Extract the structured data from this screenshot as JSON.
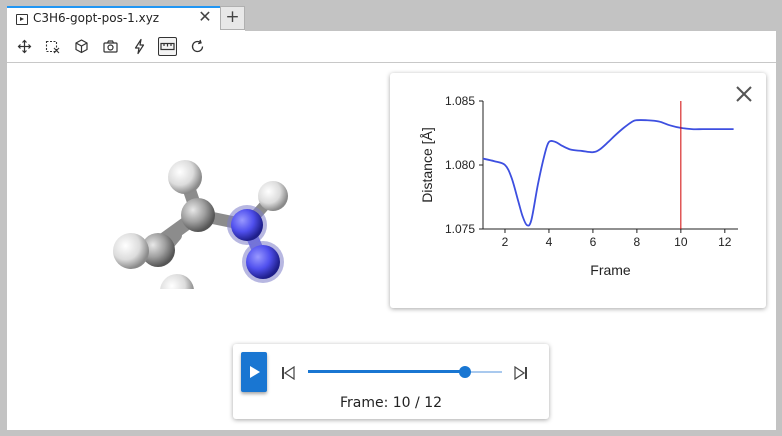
{
  "tab": {
    "title": "C3H6-gopt-pos-1.xyz",
    "close_symbol": "✕",
    "add_symbol": "+"
  },
  "toolbar": {
    "tools": [
      {
        "name": "move",
        "icon": "move-arrows-icon"
      },
      {
        "name": "select",
        "icon": "box-select-icon"
      },
      {
        "name": "cube",
        "icon": "cube-icon"
      },
      {
        "name": "camera",
        "icon": "camera-icon"
      },
      {
        "name": "lightning",
        "icon": "lightning-icon"
      },
      {
        "name": "ruler",
        "icon": "ruler-icon",
        "active": true
      },
      {
        "name": "reset",
        "icon": "refresh-icon"
      }
    ]
  },
  "colors": {
    "accent": "#1976d2",
    "tab_border": "#2196f3",
    "line": "#3d4fe0",
    "marker": "#d00000",
    "atom_carbon": "#a3a3a3",
    "atom_hydrogen": "#e6e6e6",
    "atom_nitrogen": "#5555ee"
  },
  "chart_data": {
    "type": "line",
    "xlabel": "Frame",
    "ylabel": "Distance [Å]",
    "xlim": [
      1,
      12.6
    ],
    "ylim": [
      1.075,
      1.085
    ],
    "xticks": [
      2,
      4,
      6,
      8,
      10,
      12
    ],
    "yticks": [
      "1.075",
      "1.080",
      "1.085"
    ],
    "series": [
      {
        "x": [
          1,
          1.5,
          2,
          2.3,
          2.6,
          2.8,
          3.0,
          3.2,
          3.5,
          3.8,
          4.0,
          4.3,
          4.6,
          5.0,
          5.5,
          6.0,
          6.3,
          6.7,
          7.0,
          7.4,
          7.8,
          8.0,
          8.4,
          9.0,
          9.5,
          10.0,
          10.5,
          11.0,
          11.5,
          12.0,
          12.4
        ],
        "y": [
          1.0805,
          1.0803,
          1.08,
          1.079,
          1.0772,
          1.076,
          1.0753,
          1.0757,
          1.0785,
          1.0808,
          1.0818,
          1.0818,
          1.0815,
          1.0812,
          1.0811,
          1.081,
          1.0812,
          1.0818,
          1.0823,
          1.0829,
          1.0834,
          1.0835,
          1.0835,
          1.0834,
          1.0831,
          1.0829,
          1.0828,
          1.0828,
          1.0828,
          1.0828,
          1.0828
        ]
      }
    ],
    "marker_x": 10
  },
  "player": {
    "frame_label": "Frame: 10 / 12",
    "current": 10,
    "total": 12,
    "progress": 0.81
  }
}
